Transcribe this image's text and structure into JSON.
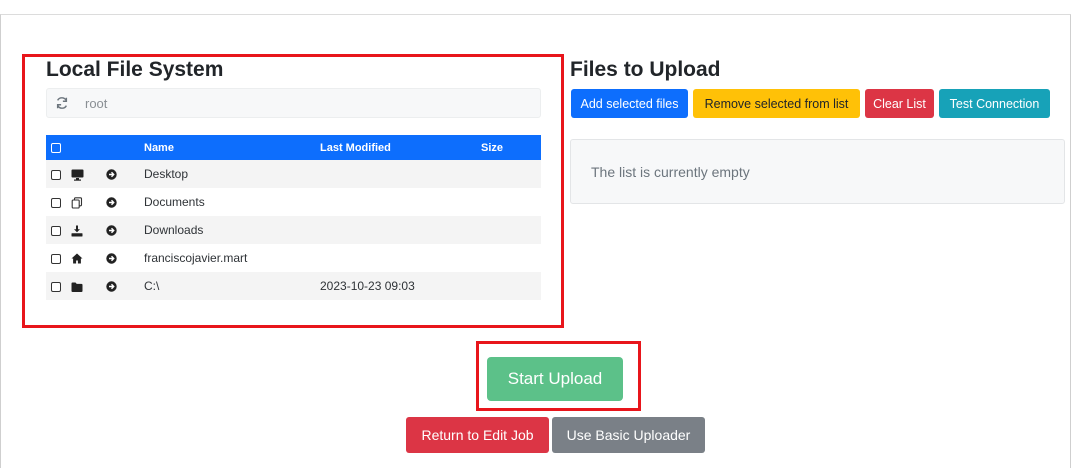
{
  "local": {
    "title": "Local File System",
    "path": "root",
    "columns": {
      "name": "Name",
      "modified": "Last Modified",
      "size": "Size"
    },
    "rows": [
      {
        "icon": "monitor-icon",
        "name": "Desktop",
        "modified": "",
        "size": ""
      },
      {
        "icon": "documents-icon",
        "name": "Documents",
        "modified": "",
        "size": ""
      },
      {
        "icon": "download-icon",
        "name": "Downloads",
        "modified": "",
        "size": ""
      },
      {
        "icon": "home-icon",
        "name": "franciscojavier.mart",
        "modified": "",
        "size": ""
      },
      {
        "icon": "folder-icon",
        "name": "C:\\",
        "modified": "2023-10-23 09:03",
        "size": ""
      }
    ]
  },
  "upload": {
    "title": "Files to Upload",
    "buttons": {
      "add": "Add selected files",
      "remove": "Remove selected from list",
      "clear": "Clear List",
      "test": "Test Connection"
    },
    "empty_message": "The list is currently empty"
  },
  "actions": {
    "start": "Start Upload",
    "return": "Return to Edit Job",
    "basic": "Use Basic Uploader"
  },
  "colors": {
    "primary": "#0d6efd",
    "warning": "#ffc107",
    "danger": "#dc3545",
    "info": "#17a2b8",
    "success_light": "#5cc189",
    "secondary": "#7a8087",
    "annotation_red": "#e8151b"
  }
}
